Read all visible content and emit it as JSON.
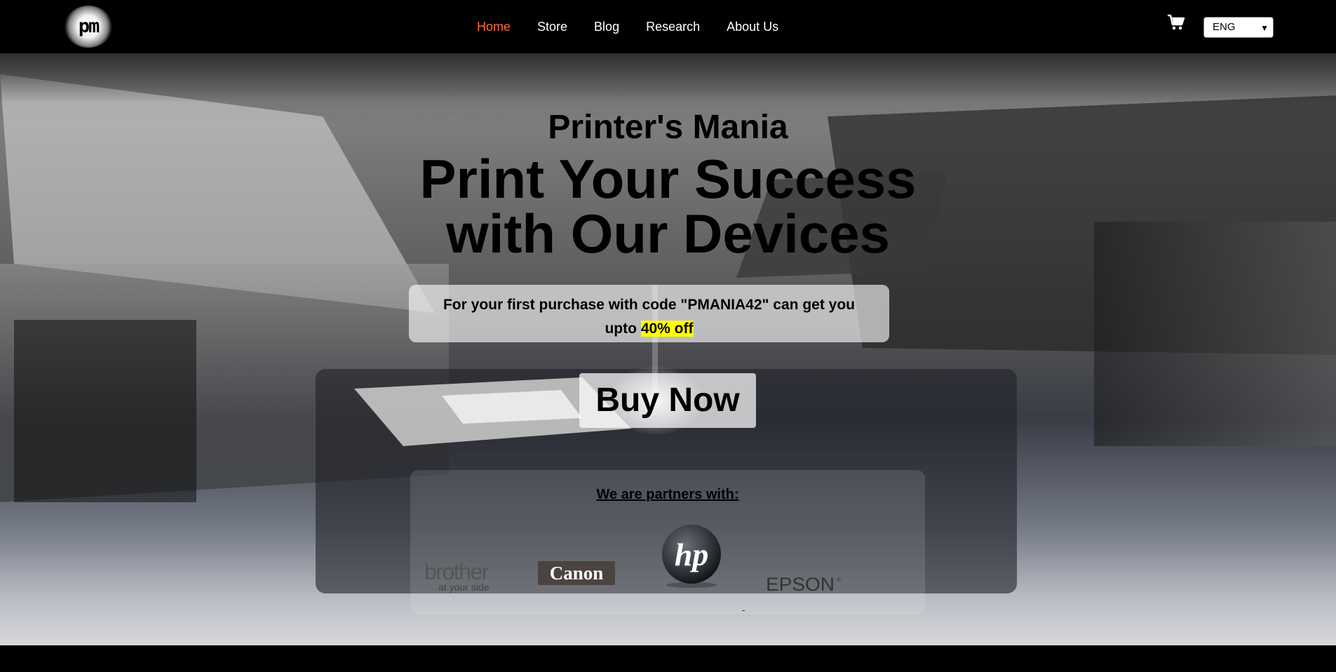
{
  "nav": {
    "logo_text": "pm",
    "links": [
      "Home",
      "Store",
      "Blog",
      "Research",
      "About Us"
    ],
    "active": "Home",
    "language": "ENG"
  },
  "hero": {
    "brand": "Printer's Mania",
    "headline_line1": "Print Your Success",
    "headline_line2": "with Our Devices",
    "promo_line1": "For your first purchase with code \"PMANIA42\" can get you",
    "promo_prefix": "upto",
    "promo_highlight": "40% off",
    "cta": "Buy Now"
  },
  "partners": {
    "title": "We are partners with:",
    "logos": [
      {
        "name": "brother",
        "tagline": "at your side"
      },
      {
        "name": "Canon"
      },
      {
        "name": "hp"
      },
      {
        "name": "EPSON"
      }
    ]
  },
  "colors": {
    "nav_bg": "#000000",
    "active_link": "#ff6a3d",
    "highlight": "#ffff00"
  }
}
